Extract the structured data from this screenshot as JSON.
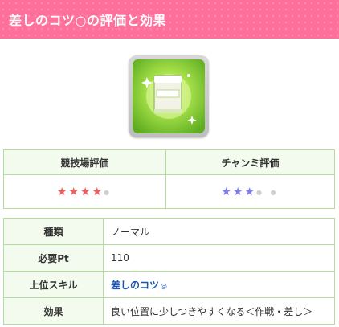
{
  "header": {
    "title": "差しのコツ○の評価と効果"
  },
  "skill_icon": {
    "icon_name": "green-book-icon"
  },
  "evaluation": {
    "arena_header": "競技場評価",
    "champion_header": "チャンミ評価",
    "arena_stars_filled": "★★★★",
    "arena_stars_empty": "●",
    "champion_stars_filled": "★★★",
    "champion_stars_empty": "● ●",
    "arena_rating": "4 / 5",
    "champion_rating": "3 / 5"
  },
  "info": {
    "rows": [
      {
        "label": "種類",
        "value": "ノーマル"
      },
      {
        "label": "必要Pt",
        "value": "110"
      },
      {
        "label": "上位スキル",
        "value": "差しのコツ",
        "suffix": "◎"
      },
      {
        "label": "効果",
        "value": "良い位置に少しつきやすくなる＜作戦・差し＞"
      }
    ]
  },
  "colors": {
    "header_bg": "#ff6f9b",
    "table_border": "#b5dba1",
    "table_header_bg": "#f3fbee",
    "star_red": "#f15c5c",
    "star_blue": "#7c7cf0",
    "link": "#1a57b5"
  }
}
